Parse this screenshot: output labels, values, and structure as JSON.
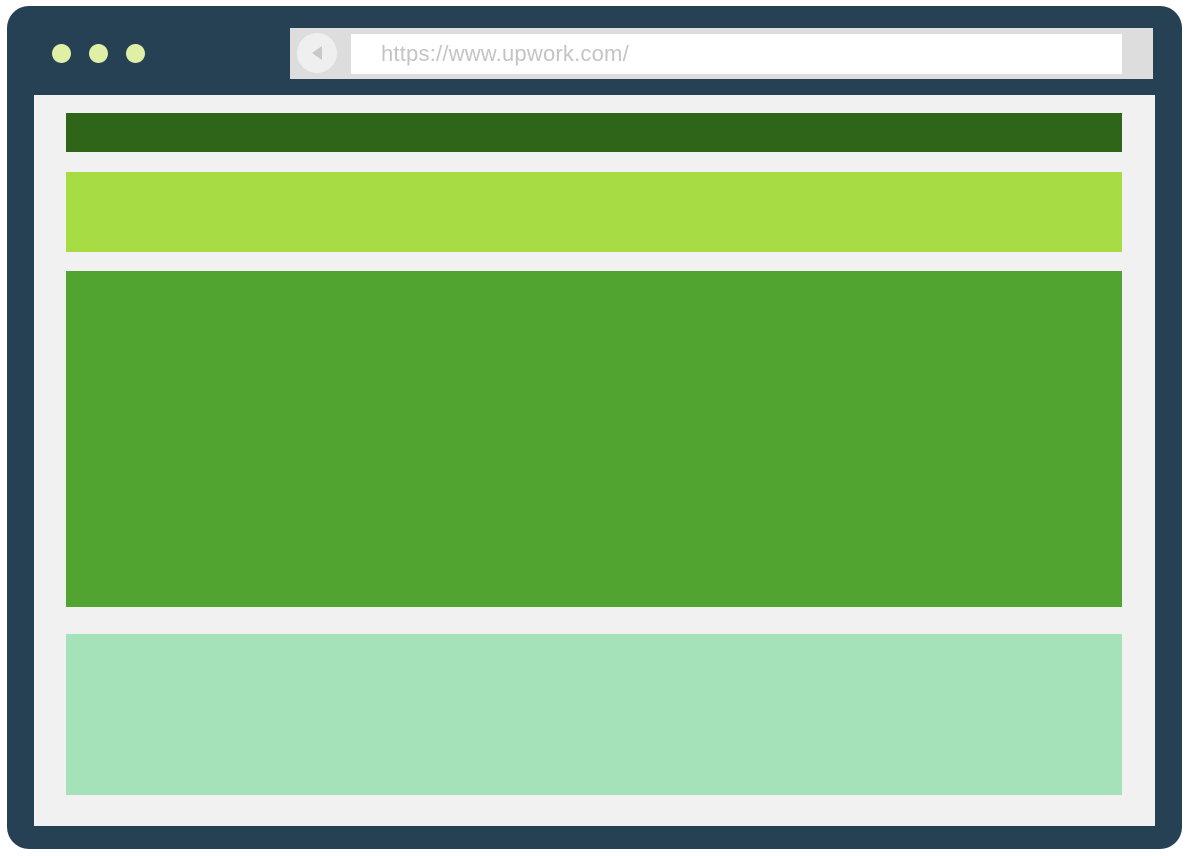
{
  "browser": {
    "url": "https://www.upwork.com/",
    "back_icon": "back-arrow-icon"
  },
  "colors": {
    "frame": "#264153",
    "traffic_light": "#dff0a6",
    "nav_bar": "#2f6519",
    "header_band": "#a8dc44",
    "hero": "#50a42f",
    "footer_block": "#a5e2b9",
    "viewport_bg": "#f1f1f1"
  }
}
